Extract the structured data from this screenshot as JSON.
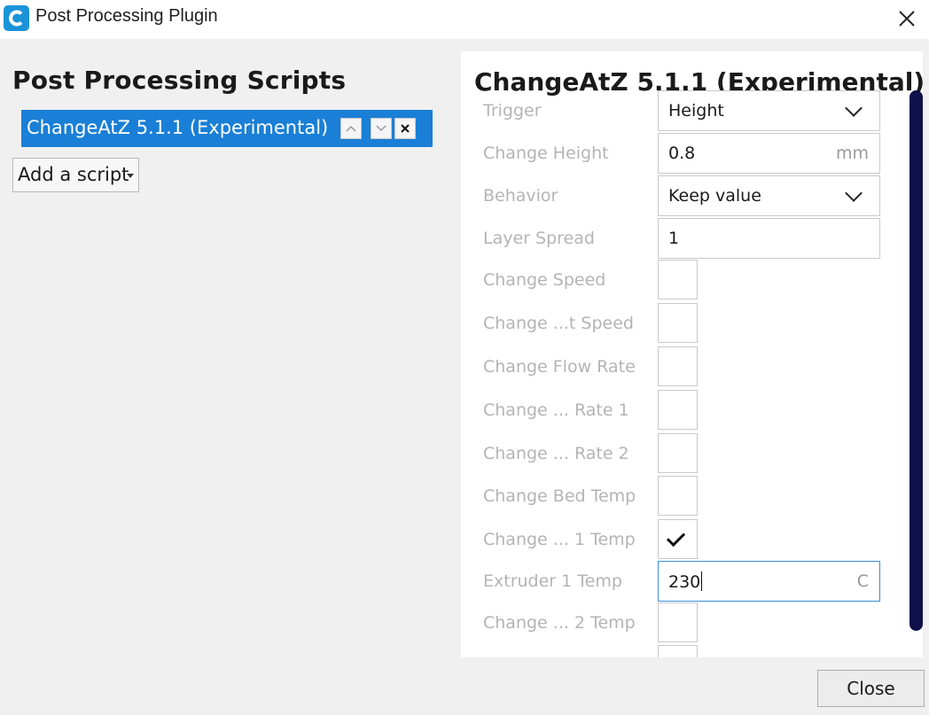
{
  "window": {
    "title": "Post Processing Plugin",
    "app_icon": "cura-logo-icon",
    "close_icon": "close-icon"
  },
  "left_panel": {
    "heading": "Post Processing Scripts",
    "scripts": [
      {
        "label": "ChangeAtZ 5.1.1 (Experimental)",
        "selected": true
      }
    ],
    "add_script_label": "Add a script",
    "accent_color": "#1a7fd6"
  },
  "settings": {
    "heading": "ChangeAtZ 5.1.1 (Experimental)",
    "rows": [
      {
        "label": "Trigger",
        "type": "dropdown",
        "value": "Height"
      },
      {
        "label": "Change Height",
        "type": "number",
        "value": "0.8",
        "unit": "mm"
      },
      {
        "label": "Behavior",
        "type": "dropdown",
        "value": "Keep value"
      },
      {
        "label": "Layer Spread",
        "type": "number",
        "value": "1"
      },
      {
        "label": "Change Speed",
        "type": "checkbox",
        "checked": false
      },
      {
        "label": "Change ...t Speed",
        "type": "checkbox",
        "checked": false
      },
      {
        "label": "Change Flow Rate",
        "type": "checkbox",
        "checked": false
      },
      {
        "label": "Change ... Rate 1",
        "type": "checkbox",
        "checked": false
      },
      {
        "label": "Change ... Rate 2",
        "type": "checkbox",
        "checked": false
      },
      {
        "label": "Change Bed Temp",
        "type": "checkbox",
        "checked": false
      },
      {
        "label": "Change ... 1 Temp",
        "type": "checkbox",
        "checked": true
      },
      {
        "label": "Extruder 1 Temp",
        "type": "number",
        "value": "230",
        "unit": "C",
        "focused": true
      },
      {
        "label": "Change ... 2 Temp",
        "type": "checkbox",
        "checked": false
      }
    ],
    "scrollbar_color": "#10104a"
  },
  "footer": {
    "close_label": "Close"
  }
}
